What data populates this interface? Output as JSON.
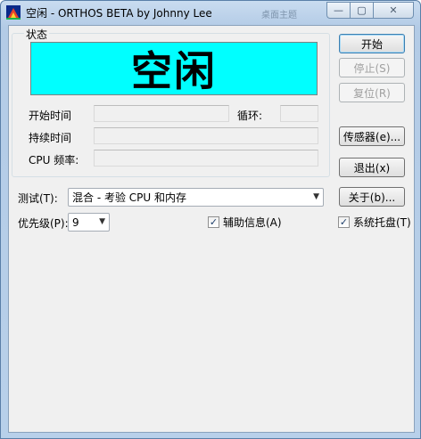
{
  "window": {
    "title": "空闲 - ORTHOS BETA by Johnny Lee",
    "faded_tab": "桌面主题",
    "minimize_glyph": "—",
    "maximize_glyph": "▢",
    "close_glyph": "✕"
  },
  "status_group": {
    "label": "状态",
    "status_text": "空闲",
    "status_color": "#00ffff",
    "start_time_label": "开始时间",
    "start_time_value": "",
    "loop_label": "循环:",
    "loop_value": "",
    "duration_label": "持续时间",
    "duration_value": "",
    "cpu_freq_label": "CPU 频率:",
    "cpu_freq_value": ""
  },
  "buttons": {
    "start": "开始",
    "stop": "停止(S)",
    "reset": "复位(R)",
    "sensors": "传感器(e)...",
    "exit": "退出(x)",
    "about": "关于(b)..."
  },
  "test": {
    "label": "测试(T):",
    "selected": "混合 - 考验 CPU 和内存"
  },
  "priority": {
    "label": "优先级(P):",
    "selected": "9"
  },
  "checkboxes": {
    "aux_info": {
      "label": "辅助信息(A)",
      "checked": true
    },
    "system_tray": {
      "label": "系统托盘(T)",
      "checked": true
    }
  },
  "icons": {
    "app": "orthos-app-icon",
    "combo_arrow": "chevron-down-icon",
    "check_mark": "✓"
  }
}
